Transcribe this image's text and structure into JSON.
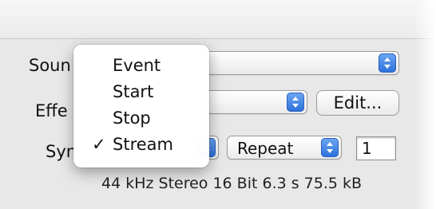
{
  "labels": {
    "sound": "Soun",
    "effect": "Effe",
    "sync": "Syn"
  },
  "sound_select": {
    "value": ""
  },
  "effect_select": {
    "value": ""
  },
  "edit_button": {
    "label": "Edit..."
  },
  "sync_select": {
    "value": ""
  },
  "repeat_select": {
    "value": "Repeat"
  },
  "repeat_count": {
    "value": "1"
  },
  "info_text": "44 kHz Stereo 16 Bit 6.3 s 75.5 kB",
  "sync_menu": {
    "items": [
      {
        "label": "Event",
        "checked": false
      },
      {
        "label": "Start",
        "checked": false
      },
      {
        "label": "Stop",
        "checked": false
      },
      {
        "label": "Stream",
        "checked": true
      }
    ],
    "check_glyph": "✓"
  },
  "colors": {
    "stepper_blue": "#2a6fdc",
    "panel_bg": "#e8e8e8"
  }
}
